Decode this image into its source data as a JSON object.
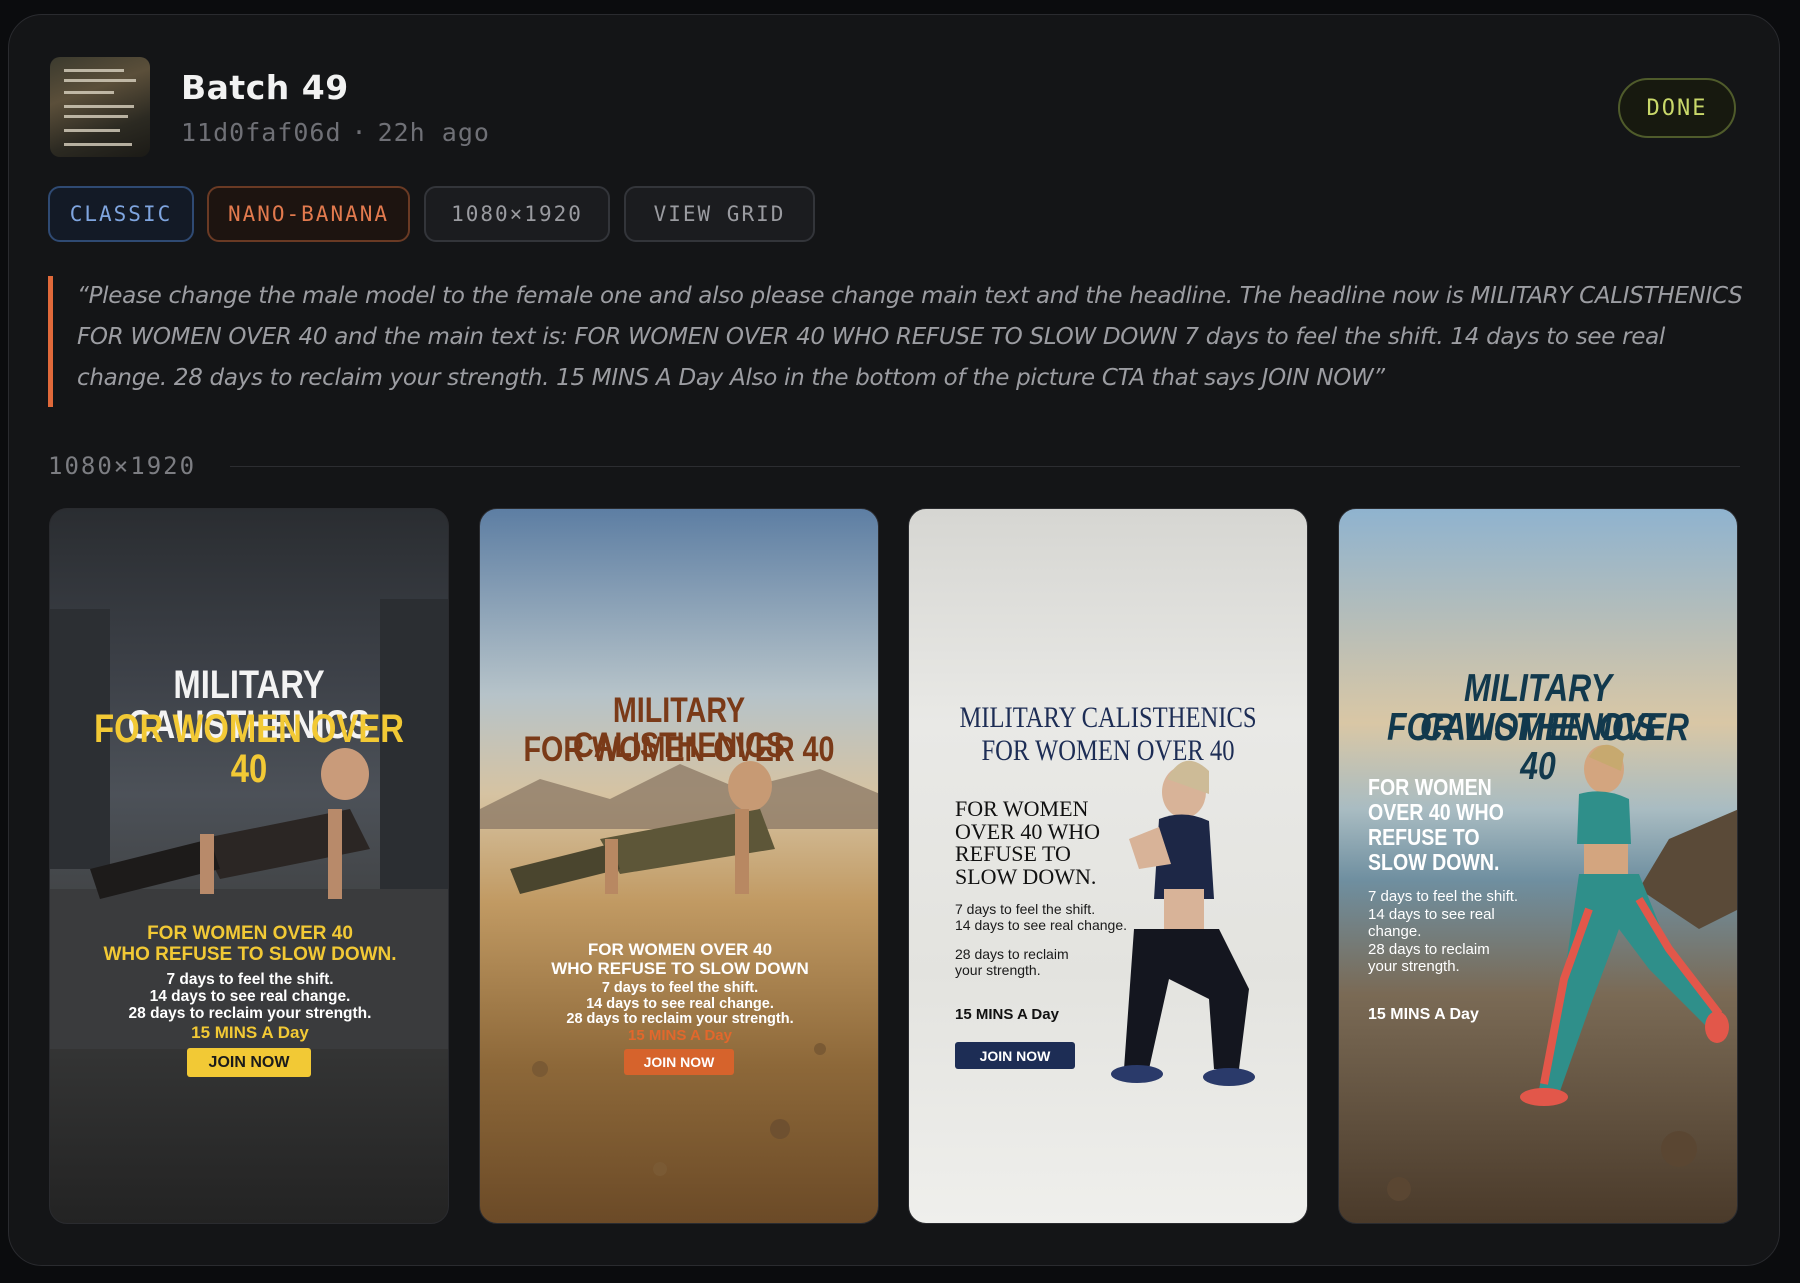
{
  "header": {
    "title": "Batch 49",
    "batch_id": "11d0faf06d",
    "separator": "·",
    "age": "22h ago",
    "status": "DONE"
  },
  "tags": {
    "style": "CLASSIC",
    "model": "NANO-BANANA",
    "size": "1080×1920",
    "view": "VIEW GRID"
  },
  "prompt": "“Please change the male model to the female one and also please change main text and the headline. The headline now is MILITARY CALISTHENICS FOR WOMEN OVER 40 and the main text is: FOR WOMEN OVER 40 WHO REFUSE TO SLOW DOWN 7 days to feel the shift. 14 days to see real change. 28 days to reclaim your strength. 15 MINS A Day Also in the bottom of the picture CTA that says JOIN NOW”",
  "section_label": "1080×1920",
  "colors": {
    "accent_orange": "#e0693a",
    "done_green": "#c9d86a",
    "classic_blue": "#7fa5df"
  },
  "tiles": [
    {
      "headline_1": "MILITARY CALISTHENICS",
      "headline_2": "FOR WOMEN OVER 40",
      "sub": "FOR WOMEN OVER 40\nWHO REFUSE TO SLOW DOWN.",
      "body": "7 days to feel the shift.\n14 days to see real change.\n28 days to reclaim your strength.",
      "mins": "15 MINS A Day",
      "cta": "JOIN NOW"
    },
    {
      "headline_1": "MILITARY CALISTHENICS",
      "headline_2": "FOR WOMEN OVER 40",
      "sub": "FOR WOMEN OVER 40\nWHO REFUSE TO SLOW DOWN",
      "body": "7 days to feel the shift.\n14 days to see real change.\n28 days to reclaim your strength.",
      "mins": "15 MINS A Day",
      "cta": "JOIN NOW"
    },
    {
      "headline_1": "MILITARY CALISTHENICS",
      "headline_2": "FOR WOMEN OVER 40",
      "sub": "FOR WOMEN\nOVER 40 WHO\nREFUSE TO\nSLOW DOWN.",
      "body": "7 days to feel the shift.\n14 days to see real change.",
      "body_2": "28 days to reclaim\nyour strength.",
      "mins": "15 MINS A Day",
      "cta": "JOIN NOW"
    },
    {
      "headline_1": "MILITARY CALISTHENICS",
      "headline_2": "FOR WOMEN OVER 40",
      "sub": "FOR WOMEN\nOVER 40 WHO\nREFUSE TO\nSLOW DOWN.",
      "body": "7 days to feel the shift.\n14 days to see real\nchange.\n28 days to reclaim\nyour strength.",
      "mins": "15 MINS A Day"
    }
  ]
}
